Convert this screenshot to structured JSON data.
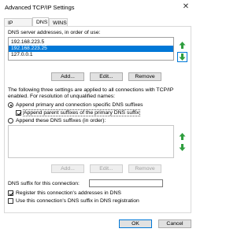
{
  "window": {
    "title": "Advanced TCP/IP Settings",
    "close_glyph": "✕"
  },
  "tabs": [
    {
      "label": "IP Settings"
    },
    {
      "label": "DNS"
    },
    {
      "label": "WINS"
    }
  ],
  "dns_servers": {
    "label": "DNS server addresses, in order of use:",
    "items": [
      "192.168.223.5",
      "192.168.223.25",
      "127.0.0.1"
    ],
    "selected_index": 1,
    "buttons": {
      "add": "Add...",
      "edit": "Edit...",
      "remove": "Remove"
    }
  },
  "resolution": {
    "info_line1": "The following three settings are applied to all connections with TCP/IP",
    "info_line2": "enabled. For resolution of unqualified names:",
    "radio_primary": "Append primary and connection specific DNS suffixes",
    "check_parent": "Append parent suffixes of the primary DNS suffix",
    "radio_these": "Append these DNS suffixes (in order):"
  },
  "suffix_list": {
    "buttons": {
      "add": "Add...",
      "edit": "Edit...",
      "remove": "Remove"
    }
  },
  "connection": {
    "suffix_label": "DNS suffix for this connection:",
    "suffix_value": "",
    "register_label": "Register this connection's addresses in DNS",
    "use_suffix_label": "Use this connection's DNS suffix in DNS registration"
  },
  "footer": {
    "ok": "OK",
    "cancel": "Cancel"
  },
  "colors": {
    "selection": "#0078d7",
    "arrow_green": "#2e9e3e",
    "disabled_arrow": "#a8d5ad"
  }
}
